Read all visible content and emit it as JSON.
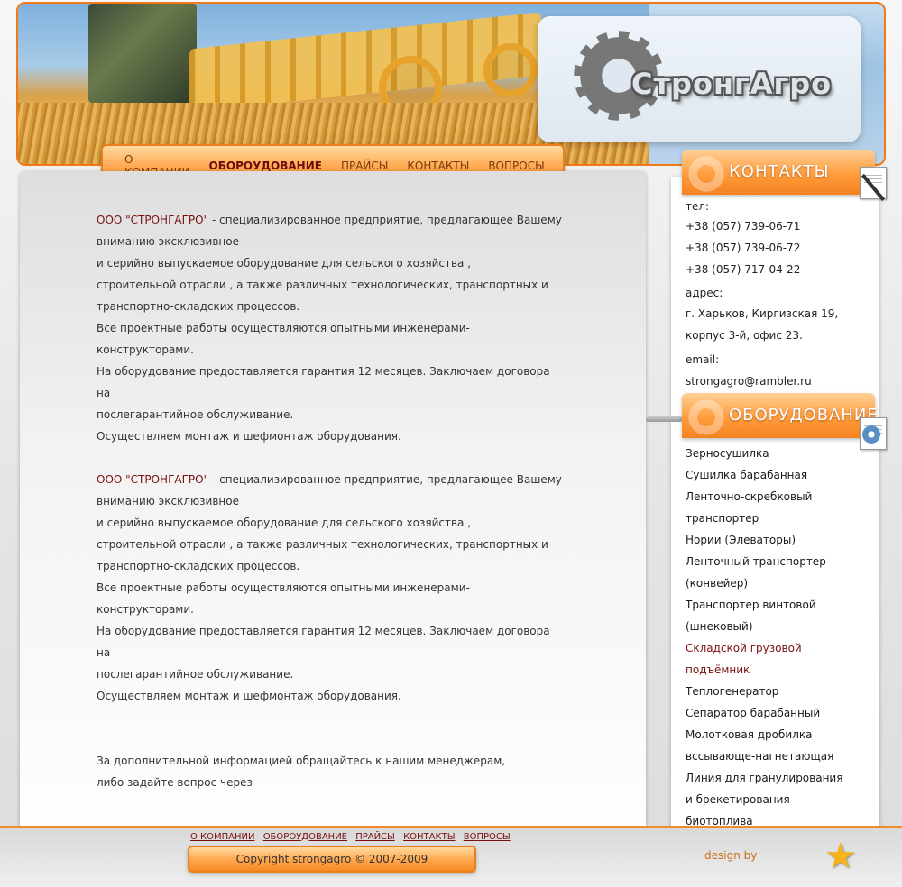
{
  "header": {
    "brand": "СтронгАгро"
  },
  "nav": {
    "items": [
      {
        "label": "О КОМПАНИИ"
      },
      {
        "label": "ОБОРОУДОВАНИЕ"
      },
      {
        "label": "ПРАЙСЫ"
      },
      {
        "label": "КОНТАКТЫ"
      },
      {
        "label": "ВОПРОСЫ"
      }
    ]
  },
  "content": {
    "block1": {
      "company": "ООО \"СТРОНГАГРО\"",
      "line1_rest": " - специализированное предприятие, предлагающее Вашему",
      "line2": "вниманию эксклюзивное",
      "line3": "и серийно выпускаемое оборудование для сельского хозяйства ,",
      "line4": "строительной отрасли , а также различных технологических, транспортных и",
      "line5": "транспортно-складских процессов.",
      "line6": "Все проектные работы осуществляются опытными инженерами- конструкторами.",
      "line7": "На оборудование предоставляется гарантия 12 месяцев. Заключаем договора на",
      "line8": "послегарантийное обслуживание.",
      "line9": "Осуществляем монтаж и шефмонтаж оборудования."
    },
    "block2": {
      "company": "ООО \"СТРОНГАГРО\"",
      "line1_rest": " - специализированное предприятие, предлагающее Вашему",
      "line2": "вниманию эксклюзивное",
      "line3": "и серийно выпускаемое оборудование для сельского хозяйства ,",
      "line4": "строительной отрасли , а также различных технологических, транспортных и",
      "line5": "транспортно-складских процессов.",
      "line6": "Все проектные работы осуществляются опытными инженерами- конструкторами.",
      "line7": "На оборудование предоставляется гарантия 12 месяцев. Заключаем договора на",
      "line8": "послегарантийное обслуживание.",
      "line9": "Осуществляем монтаж и шефмонтаж оборудования."
    },
    "closing1": "За дополнительной информацией обращайтесь к нашим менеджерам,",
    "closing2": "либо задайте вопрос через"
  },
  "sidebar": {
    "contacts_title": "КОНТАКТЫ",
    "tel_label": "тел:",
    "phones": [
      "+38 (057) 739-06-71",
      "+38 (057) 739-06-72",
      "+38 (057) 717-04-22"
    ],
    "address_label": "адрес:",
    "address1": "г. Харьков, Киргизская 19,",
    "address2": "корпус 3-й, офис 23.",
    "email_label": "email:",
    "email": "strongagro@rambler.ru",
    "equipment_title": "ОБОРУДОВАНИЕ",
    "equipment": [
      "Зерносушилка",
      "Сушилка барабанная",
      "Ленточно-скребковый",
      "транспортер",
      "Нории (Элеваторы)",
      "Ленточный транспортер",
      "(конвейер)",
      "Транспортер винтовой",
      "(шнековый)",
      "Складской грузовой",
      "подъёмник",
      "Теплогенератор",
      "Сепаратор барабанный",
      "Молотковая дробилка",
      "вссывающе-нагнетающая",
      "Линия для гранулирования",
      "и брекетирования",
      "биотоплива"
    ]
  },
  "footer": {
    "links": [
      "О КОМПАНИИ",
      "ОБОРОУДОВАНИЕ",
      "ПРАЙСЫ",
      "КОНТАКТЫ",
      "ВОПРОСЫ"
    ],
    "copyright": "Copyright strongagro © 2007-2009",
    "design_by": "design by"
  },
  "colors": {
    "accent": "#f68a22",
    "link_dark": "#7a1010"
  }
}
